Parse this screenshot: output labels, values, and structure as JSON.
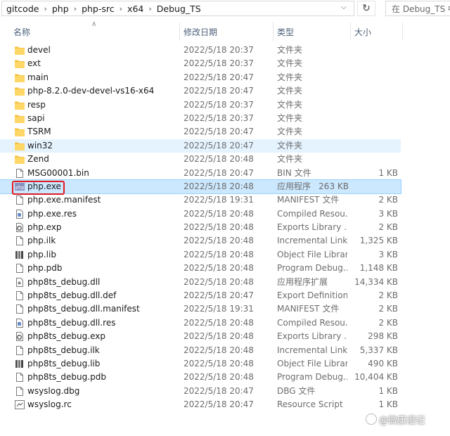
{
  "breadcrumb": [
    "gitcode",
    "php",
    "php-src",
    "x64",
    "Debug_TS"
  ],
  "search_placeholder": "在 Debug_TS 中搜",
  "columns": {
    "name": "名称",
    "modified": "修改日期",
    "type": "类型",
    "size": "大小"
  },
  "files": [
    {
      "name": "devel",
      "modified": "2022/5/18 20:37",
      "type": "文件夹",
      "size": "",
      "icon": "folder-icon"
    },
    {
      "name": "ext",
      "modified": "2022/5/18 20:37",
      "type": "文件夹",
      "size": "",
      "icon": "folder-icon"
    },
    {
      "name": "main",
      "modified": "2022/5/18 20:47",
      "type": "文件夹",
      "size": "",
      "icon": "folder-icon"
    },
    {
      "name": "php-8.2.0-dev-devel-vs16-x64",
      "modified": "2022/5/18 20:47",
      "type": "文件夹",
      "size": "",
      "icon": "folder-icon"
    },
    {
      "name": "resp",
      "modified": "2022/5/18 20:37",
      "type": "文件夹",
      "size": "",
      "icon": "folder-icon"
    },
    {
      "name": "sapi",
      "modified": "2022/5/18 20:37",
      "type": "文件夹",
      "size": "",
      "icon": "folder-icon"
    },
    {
      "name": "TSRM",
      "modified": "2022/5/18 20:47",
      "type": "文件夹",
      "size": "",
      "icon": "folder-icon"
    },
    {
      "name": "win32",
      "modified": "2022/5/18 20:47",
      "type": "文件夹",
      "size": "",
      "icon": "folder-icon"
    },
    {
      "name": "Zend",
      "modified": "2022/5/18 20:48",
      "type": "文件夹",
      "size": "",
      "icon": "folder-icon"
    },
    {
      "name": "MSG00001.bin",
      "modified": "2022/5/18 20:47",
      "type": "BIN 文件",
      "size": "1 KB",
      "icon": "file-icon"
    },
    {
      "name": "php.exe",
      "modified": "2022/5/18 20:48",
      "type": "应用程序",
      "size": "263 KB",
      "icon": "php-exe-icon"
    },
    {
      "name": "php.exe.manifest",
      "modified": "2022/5/18 19:31",
      "type": "MANIFEST 文件",
      "size": "2 KB",
      "icon": "file-icon"
    },
    {
      "name": "php.exe.res",
      "modified": "2022/5/18 20:48",
      "type": "Compiled Resou...",
      "size": "3 KB",
      "icon": "resource-icon"
    },
    {
      "name": "php.exp",
      "modified": "2022/5/18 20:48",
      "type": "Exports Library ...",
      "size": "2 KB",
      "icon": "gear-file-icon"
    },
    {
      "name": "php.ilk",
      "modified": "2022/5/18 20:48",
      "type": "Incremental Link...",
      "size": "1,325 KB",
      "icon": "file-icon"
    },
    {
      "name": "php.lib",
      "modified": "2022/5/18 20:48",
      "type": "Object File Library",
      "size": "3 KB",
      "icon": "library-icon"
    },
    {
      "name": "php.pdb",
      "modified": "2022/5/18 20:48",
      "type": "Program Debug...",
      "size": "1,148 KB",
      "icon": "file-icon"
    },
    {
      "name": "php8ts_debug.dll",
      "modified": "2022/5/18 20:48",
      "type": "应用程序扩展",
      "size": "14,334 KB",
      "icon": "dll-icon"
    },
    {
      "name": "php8ts_debug.dll.def",
      "modified": "2022/5/18 20:47",
      "type": "Export Definition...",
      "size": "2 KB",
      "icon": "file-icon"
    },
    {
      "name": "php8ts_debug.dll.manifest",
      "modified": "2022/5/18 19:31",
      "type": "MANIFEST 文件",
      "size": "2 KB",
      "icon": "file-icon"
    },
    {
      "name": "php8ts_debug.dll.res",
      "modified": "2022/5/18 20:48",
      "type": "Compiled Resou...",
      "size": "2 KB",
      "icon": "resource-icon"
    },
    {
      "name": "php8ts_debug.exp",
      "modified": "2022/5/18 20:48",
      "type": "Exports Library ...",
      "size": "298 KB",
      "icon": "gear-file-icon"
    },
    {
      "name": "php8ts_debug.ilk",
      "modified": "2022/5/18 20:48",
      "type": "Incremental Link...",
      "size": "5,337 KB",
      "icon": "file-icon"
    },
    {
      "name": "php8ts_debug.lib",
      "modified": "2022/5/18 20:48",
      "type": "Object File Library",
      "size": "490 KB",
      "icon": "library-icon"
    },
    {
      "name": "php8ts_debug.pdb",
      "modified": "2022/5/18 20:48",
      "type": "Program Debug...",
      "size": "10,404 KB",
      "icon": "file-icon"
    },
    {
      "name": "wsyslog.dbg",
      "modified": "2022/5/18 20:47",
      "type": "DBG 文件",
      "size": "1 KB",
      "icon": "file-icon"
    },
    {
      "name": "wsyslog.rc",
      "modified": "2022/5/18 20:47",
      "type": "Resource Script",
      "size": "1 KB",
      "icon": "script-icon"
    }
  ],
  "watermark": "@微康漫记",
  "colors": {
    "folder": "#f5c343",
    "selected_bg": "#cce8ff",
    "hover_bg": "#e5f3ff",
    "highlight_box": "#e0191f",
    "header_text": "#4c607a"
  }
}
